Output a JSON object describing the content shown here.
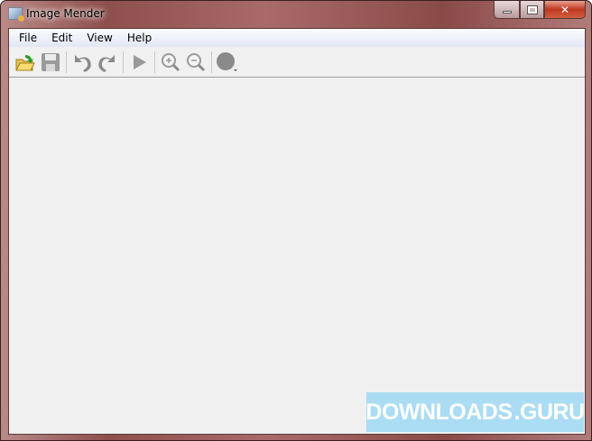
{
  "window": {
    "title": "Image Mender"
  },
  "menu": [
    "File",
    "Edit",
    "View",
    "Help"
  ],
  "toolbar": {
    "buttons": [
      {
        "name": "open",
        "icon": "folder-open-icon"
      },
      {
        "name": "save",
        "icon": "floppy-disk-icon"
      },
      {
        "name": "undo",
        "icon": "undo-icon"
      },
      {
        "name": "redo",
        "icon": "redo-icon"
      },
      {
        "name": "run",
        "icon": "play-icon"
      },
      {
        "name": "zoom-in",
        "icon": "zoom-in-icon"
      },
      {
        "name": "zoom-out",
        "icon": "zoom-out-icon"
      },
      {
        "name": "brush",
        "icon": "circle-brush-icon"
      }
    ]
  },
  "watermark": {
    "text": "DOWNLOADS",
    ".suffix": ".GURU",
    "suffix": ".GURU"
  }
}
